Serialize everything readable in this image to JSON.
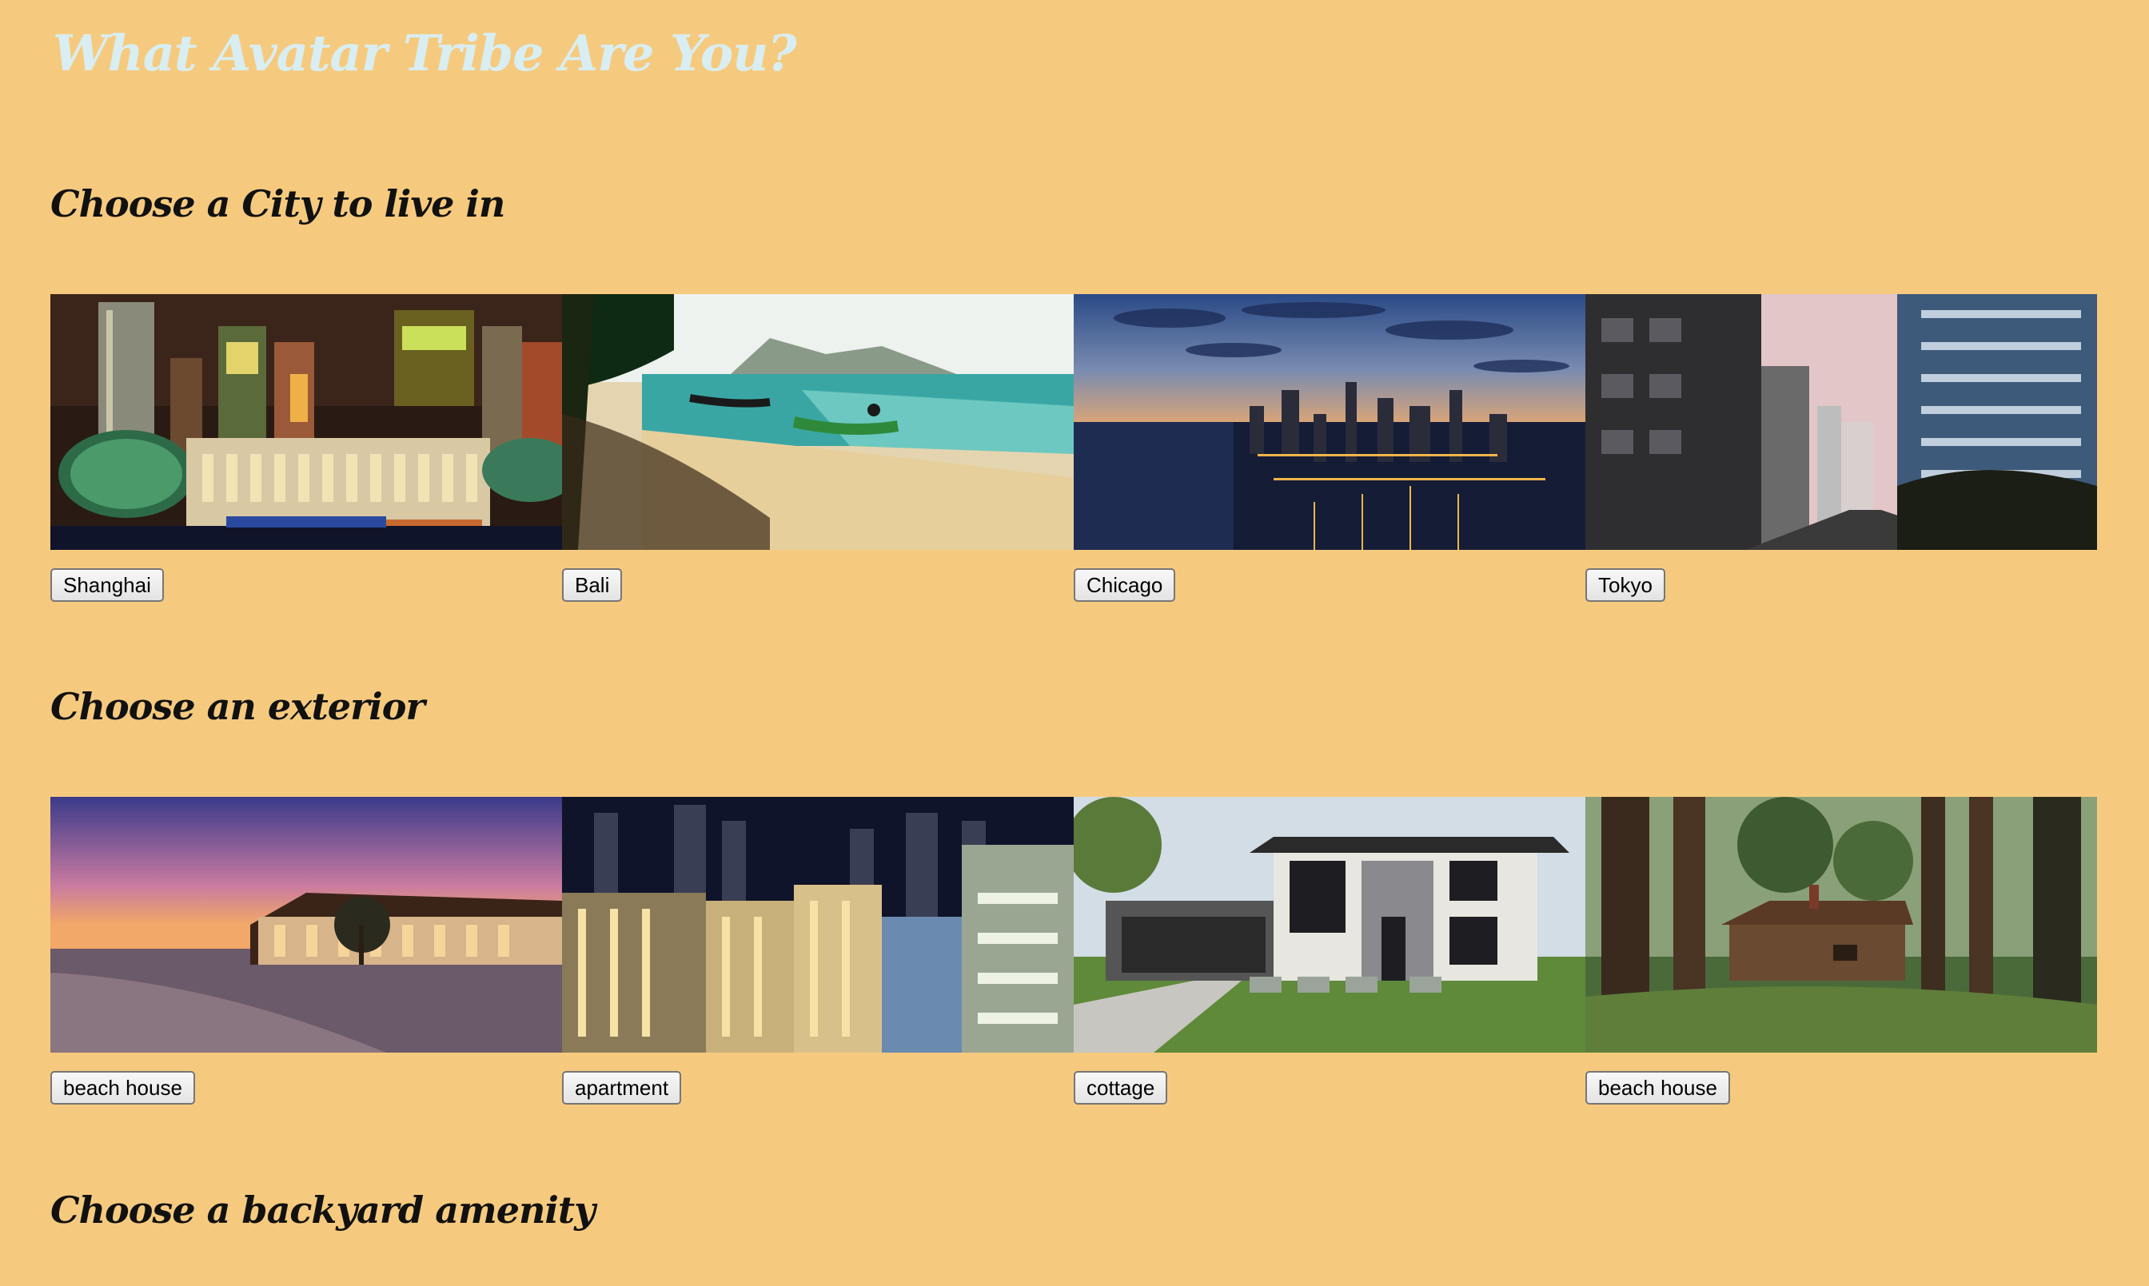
{
  "page": {
    "title": "What Avatar Tribe Are You?",
    "background_color": "#F6CA7E",
    "title_color": "#D8EEF2"
  },
  "sections": [
    {
      "heading": "Choose a City to live in",
      "options": [
        {
          "label": "Shanghai",
          "image": "shanghai-night-skyline-image"
        },
        {
          "label": "Bali",
          "image": "bali-beach-boats-image"
        },
        {
          "label": "Chicago",
          "image": "chicago-aerial-dusk-image"
        },
        {
          "label": "Tokyo",
          "image": "tokyo-street-buildings-image"
        }
      ]
    },
    {
      "heading": "Choose an exterior",
      "options": [
        {
          "label": "beach house",
          "image": "waterfront-house-sunset-image"
        },
        {
          "label": "apartment",
          "image": "apartment-towers-night-image"
        },
        {
          "label": "cottage",
          "image": "modern-house-lawn-image"
        },
        {
          "label": "beach house",
          "image": "forest-log-cabin-image"
        }
      ]
    },
    {
      "heading": "Choose a backyard amenity"
    }
  ]
}
